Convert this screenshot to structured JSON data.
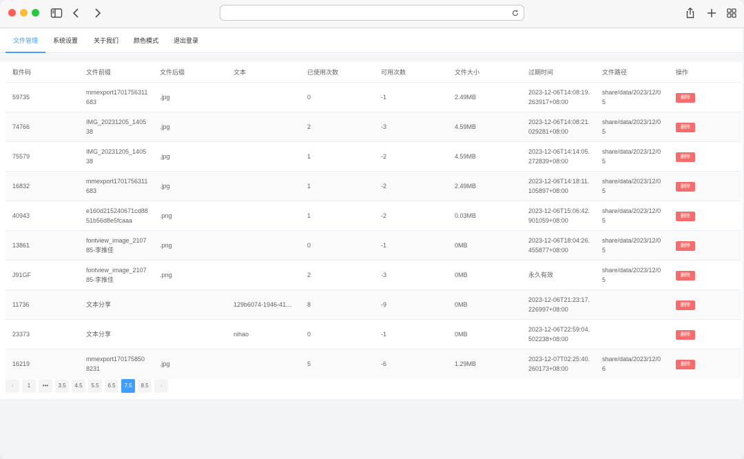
{
  "tabs": [
    {
      "label": "文件管理",
      "active": true
    },
    {
      "label": "系统设置",
      "active": false
    },
    {
      "label": "关于我们",
      "active": false
    },
    {
      "label": "颜色模式",
      "active": false
    },
    {
      "label": "退出登录",
      "active": false
    }
  ],
  "table": {
    "headers": [
      "取件码",
      "文件前缀",
      "文件后缀",
      "文本",
      "已使用次数",
      "可用次数",
      "文件大小",
      "过期时间",
      "文件路径",
      "操作"
    ],
    "rows": [
      {
        "code": "59735",
        "prefix": "mmexport1701756311683",
        "suffix": ".jpg",
        "text": "",
        "used": "0",
        "available": "-1",
        "size": "2.49MB",
        "expires": "2023-12-06T14:08:19.263917+08:00",
        "path": "share/data/2023/12/05",
        "action": "删除"
      },
      {
        "code": "74766",
        "prefix": "IMG_20231205_140538",
        "suffix": ".jpg",
        "text": "",
        "used": "2",
        "available": "-3",
        "size": "4.59MB",
        "expires": "2023-12-06T14:08:21.029281+08:00",
        "path": "share/data/2023/12/05",
        "action": "删除"
      },
      {
        "code": "75579",
        "prefix": "IMG_20231205_140538",
        "suffix": ".jpg",
        "text": "",
        "used": "1",
        "available": "-2",
        "size": "4.59MB",
        "expires": "2023-12-06T14:14:05.272839+08:00",
        "path": "share/data/2023/12/05",
        "action": "删除"
      },
      {
        "code": "16832",
        "prefix": "mmexport1701756311683",
        "suffix": ".jpg",
        "text": "",
        "used": "1",
        "available": "-2",
        "size": "2.49MB",
        "expires": "2023-12-06T14:18:11.105897+08:00",
        "path": "share/data/2023/12/05",
        "action": "删除"
      },
      {
        "code": "40943",
        "prefix": "e160d215240671cd8851b56d8e5fcaaa",
        "suffix": ".png",
        "text": "",
        "used": "1",
        "available": "-2",
        "size": "0.03MB",
        "expires": "2023-12-06T15:06:42.901059+08:00",
        "path": "share/data/2023/12/05",
        "action": "删除"
      },
      {
        "code": "13861",
        "prefix": "fontview_image_210785-李推佳",
        "suffix": ".png",
        "text": "",
        "used": "0",
        "available": "-1",
        "size": "0MB",
        "expires": "2023-12-06T18:04:26.455877+08:00",
        "path": "share/data/2023/12/05",
        "action": "删除"
      },
      {
        "code": "J91GF",
        "prefix": "fontview_image_210785-李推佳",
        "suffix": ".png",
        "text": "",
        "used": "2",
        "available": "-3",
        "size": "0MB",
        "expires": "永久有效",
        "path": "share/data/2023/12/05",
        "action": "删除"
      },
      {
        "code": "11736",
        "prefix": "文本分享",
        "suffix": "",
        "text": "129b6074-1946-41...",
        "used": "8",
        "available": "-9",
        "size": "0MB",
        "expires": "2023-12-06T21:23:17.226997+08:00",
        "path": "",
        "action": "删除"
      },
      {
        "code": "23373",
        "prefix": "文本分享",
        "suffix": "",
        "text": "nihao",
        "used": "0",
        "available": "-1",
        "size": "0MB",
        "expires": "2023-12-06T22:59:04.502238+08:00",
        "path": "",
        "action": "删除"
      },
      {
        "code": "16219",
        "prefix": "mmexport1701758508231",
        "suffix": ".jpg",
        "text": "",
        "used": "5",
        "available": "-6",
        "size": "1.29MB",
        "expires": "2023-12-07T02:25:40.260173+08:00",
        "path": "share/data/2023/12/06",
        "action": "删除"
      }
    ]
  },
  "pagination": {
    "prev": "‹",
    "next": "›",
    "pages": [
      "1",
      "•••",
      "3.5",
      "4.5",
      "5.5",
      "6.5",
      "7.5",
      "8.5"
    ],
    "active": "7.5"
  },
  "colors": {
    "accent": "#409eff",
    "danger": "#f56c6c"
  }
}
